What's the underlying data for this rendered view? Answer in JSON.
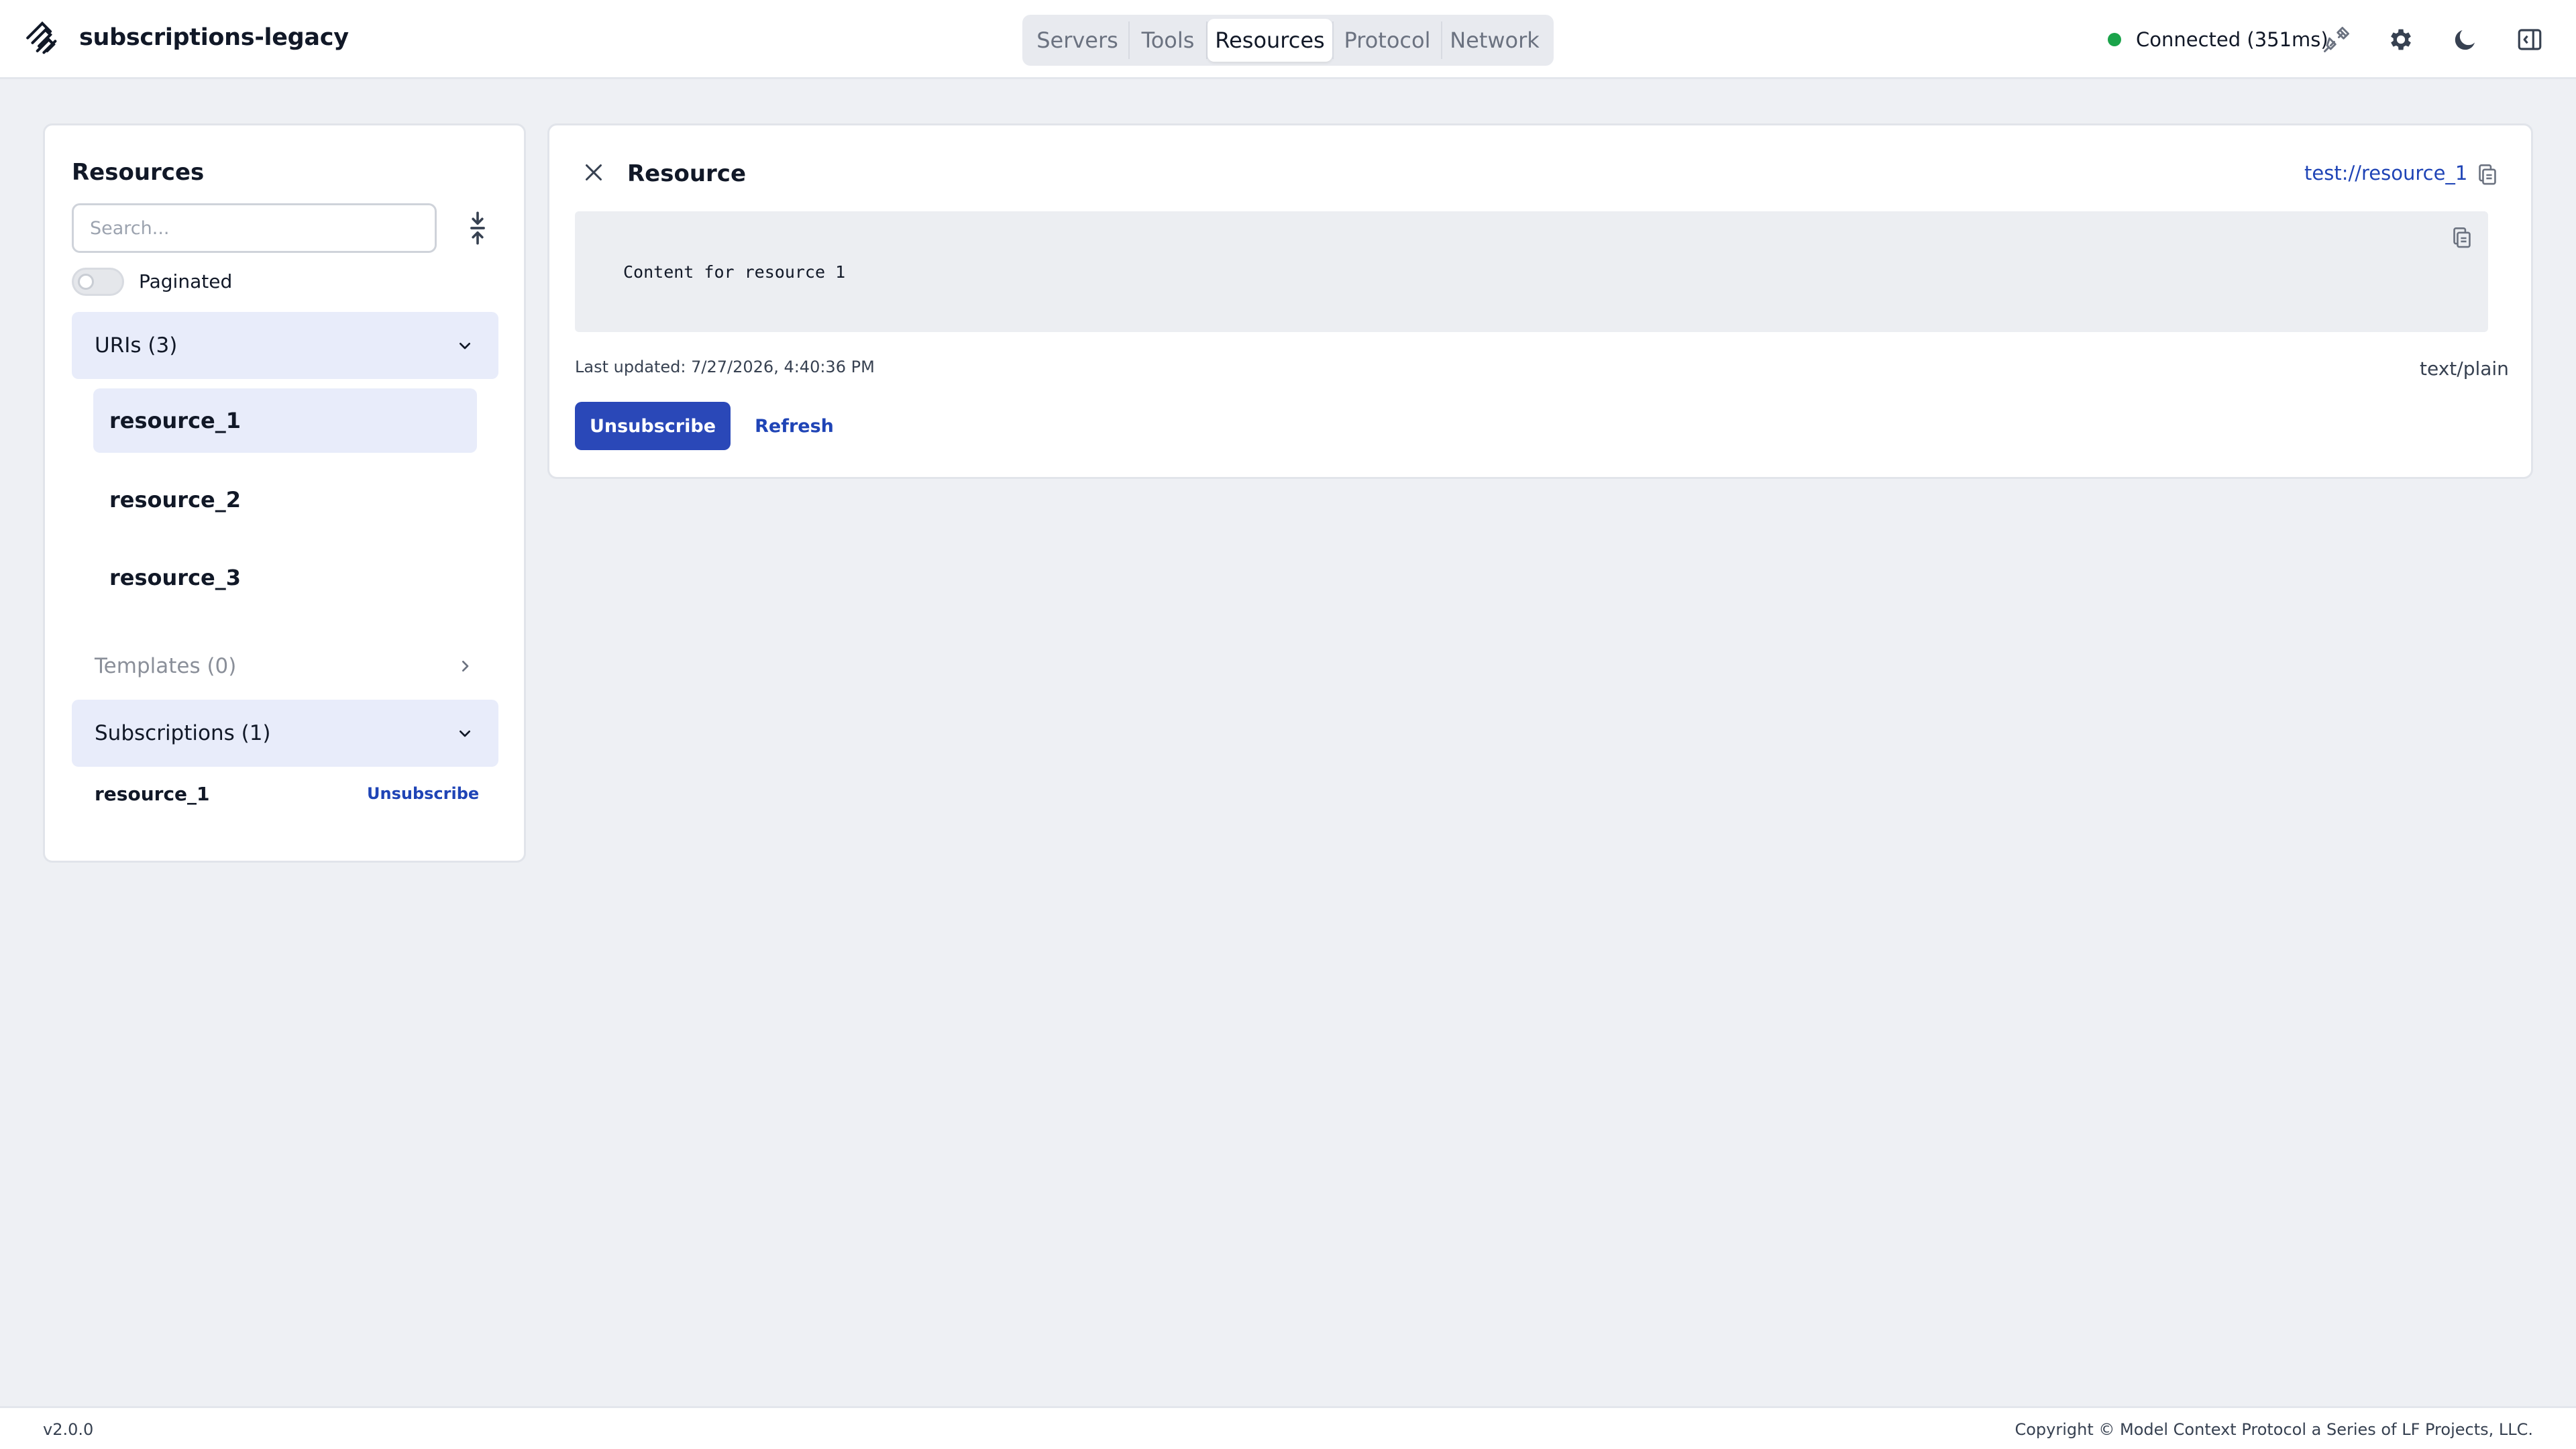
{
  "header": {
    "app_title": "subscriptions-legacy",
    "logo_icon": "mcp-logo-icon",
    "nav_tabs": [
      {
        "label": "Servers",
        "active": false
      },
      {
        "label": "Tools",
        "active": false
      },
      {
        "label": "Resources",
        "active": true
      },
      {
        "label": "Protocol",
        "active": false
      },
      {
        "label": "Network",
        "active": false
      }
    ],
    "connection": {
      "status_text": "Connected (351ms)",
      "status_color": "#1aa34a"
    },
    "icons": [
      "disconnect-plug-icon",
      "gear-icon",
      "moon-icon",
      "sidebar-toggle-icon"
    ]
  },
  "sidebar": {
    "title": "Resources",
    "search": {
      "placeholder": "Search...",
      "value": ""
    },
    "collapse_icon": "collapse-all-icon",
    "paginated": {
      "label": "Paginated",
      "enabled": false
    },
    "uris_section": {
      "label": "URIs (3)",
      "expanded": true,
      "items": [
        {
          "label": "resource_1",
          "selected": true
        },
        {
          "label": "resource_2",
          "selected": false
        },
        {
          "label": "resource_3",
          "selected": false
        }
      ]
    },
    "templates_section": {
      "label": "Templates (0)",
      "expanded": false
    },
    "subscriptions_section": {
      "label": "Subscriptions (1)",
      "expanded": true,
      "items": [
        {
          "name": "resource_1",
          "action_label": "Unsubscribe"
        }
      ]
    }
  },
  "detail": {
    "title": "Resource",
    "uri": "test://resource_1",
    "content": "Content for resource 1",
    "last_updated": "Last updated: 7/27/2026, 4:40:36 PM",
    "mime_type": "text/plain",
    "unsubscribe_label": "Unsubscribe",
    "refresh_label": "Refresh"
  },
  "footer": {
    "version": "v2.0.0",
    "copyright": "Copyright © Model Context Protocol a Series of LF Projects, LLC."
  },
  "colors": {
    "accent": "#2a48b8",
    "link": "#1f44b6",
    "selected_bg": "#e8ecfa",
    "page_bg": "#eef0f4"
  }
}
